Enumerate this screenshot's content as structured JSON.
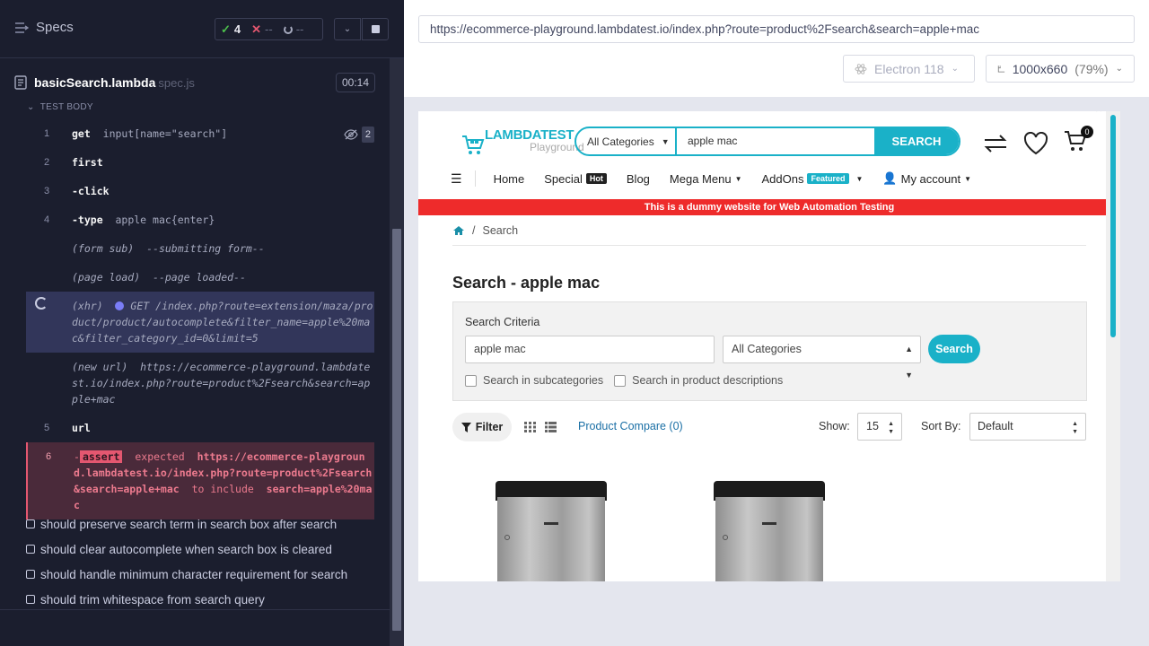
{
  "runner": {
    "header": {
      "title": "Specs"
    },
    "stats": {
      "passed": "4",
      "failed": "--",
      "pending": "--"
    },
    "spec": {
      "name": "basicSearch.lambda",
      "ext": "spec.js",
      "duration": "00:14"
    },
    "section_label": "TEST BODY",
    "hidden_count": "2",
    "commands": [
      {
        "num": "1",
        "name": "get",
        "arg": "input[name=\"search\"]"
      },
      {
        "num": "2",
        "name": "first",
        "arg": ""
      },
      {
        "num": "3",
        "name": "-click",
        "arg": ""
      },
      {
        "num": "4",
        "name": "-type",
        "arg": "apple mac{enter}"
      },
      {
        "event": "(form sub)",
        "text": "--submitting form--"
      },
      {
        "event": "(page load)",
        "text": "--page loaded--"
      },
      {
        "event": "(xhr)",
        "method": "GET",
        "text": "/index.php?route=extension/maza/product/product/autocomplete&filter_name=apple%20mac&filter_category_id=0&limit=5"
      },
      {
        "event": "(new url)",
        "text": "https://ecommerce-playground.lambdatest.io/index.php?route=product%2Fsearch&search=apple+mac"
      },
      {
        "num": "5",
        "name": "url",
        "arg": ""
      },
      {
        "num": "6",
        "prefix": "-",
        "badge": "assert",
        "msg_a": "expected",
        "msg_b": "https://ecommerce-playground.lambdatest.io/index.php?route=product%2Fsearch&search=apple+mac",
        "msg_c": "to include",
        "msg_d": "search=apple%20mac"
      }
    ],
    "tests": [
      "should preserve search term in search box after search",
      "should clear autocomplete when search box is cleared",
      "should handle minimum character requirement for search",
      "should trim whitespace from search query"
    ]
  },
  "aut": {
    "url": "https://ecommerce-playground.lambdatest.io/index.php?route=product%2Fsearch&search=apple+mac",
    "browser": "Electron 118",
    "viewport": "1000x660",
    "scale": "(79%)"
  },
  "site": {
    "logo_main": "LAMBDATEST",
    "logo_sub": "Playground",
    "search": {
      "category": "All Categories",
      "value": "apple mac",
      "button": "SEARCH"
    },
    "cart_count": "0",
    "nav": {
      "home": "Home",
      "special": "Special",
      "hot": "Hot",
      "blog": "Blog",
      "mega_menu": "Mega Menu",
      "addons": "AddOns",
      "featured": "Featured",
      "account": "My account"
    },
    "banner": "This is a dummy website for Web Automation Testing",
    "breadcrumb": "Search",
    "page_title": "Search - apple mac",
    "criteria": {
      "label": "Search Criteria",
      "value": "apple mac",
      "category": "All Categories",
      "button": "Search",
      "check_sub": "Search in subcategories",
      "check_desc": "Search in product descriptions"
    },
    "toolbar": {
      "filter": "Filter",
      "compare": "Product Compare (0)",
      "show_label": "Show:",
      "show_value": "15",
      "sort_label": "Sort By:",
      "sort_value": "Default"
    }
  },
  "colors": {
    "accent": "#1ab1c8",
    "banner": "#ee2b2b",
    "fail": "#e45770",
    "pass": "#4cbf4c"
  }
}
